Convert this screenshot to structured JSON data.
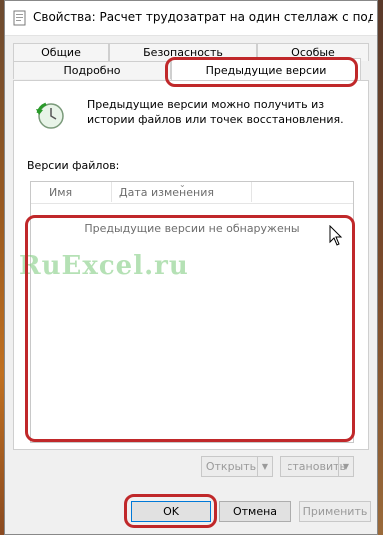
{
  "window": {
    "title": "Свойства: Расчет трудозатрат на один стеллаж с подсв..."
  },
  "tabs": {
    "row1": [
      "Общие",
      "Безопасность",
      "Особые"
    ],
    "row2": [
      "Подробно",
      "Предыдущие версии"
    ],
    "active": "Предыдущие версии"
  },
  "panel": {
    "description": "Предыдущие версии можно получить из истории файлов или точек восстановления.",
    "files_label": "Версии файлов:",
    "columns": [
      "Имя",
      "Дата изменения"
    ],
    "empty_message": "Предыдущие версии не обнаружены",
    "open_button": "Открыть",
    "restore_button": "Восстановить"
  },
  "footer": {
    "ok": "OK",
    "cancel": "Отмена",
    "apply": "Применить"
  },
  "watermark": "RuExcel.ru",
  "colors": {
    "highlight": "#c0282a",
    "watermark": "#78c878"
  }
}
